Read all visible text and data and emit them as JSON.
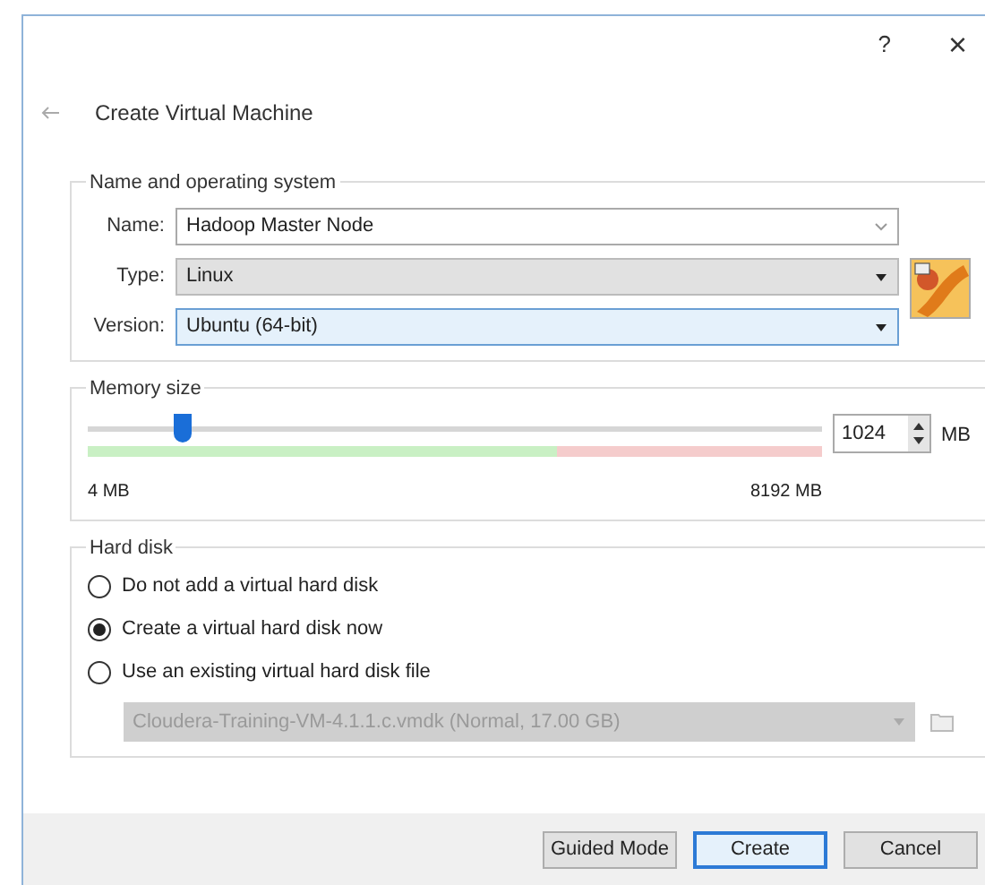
{
  "title_bar": {
    "help": "?",
    "close": "×"
  },
  "title": "Create Virtual Machine",
  "name_os": {
    "legend": "Name and operating system",
    "fields": [
      {
        "kind": "combo",
        "label": "Name:",
        "value": "Hadoop Master Node"
      },
      {
        "kind": "select",
        "label": "Type:",
        "value": "Linux",
        "focused": false
      },
      {
        "kind": "select",
        "label": "Version:",
        "value": "Ubuntu (64-bit)",
        "focused": true
      }
    ]
  },
  "memory": {
    "legend": "Memory size",
    "level": 0.13,
    "value": "1024",
    "unit": "MB",
    "min_label": "4 MB",
    "max_label": "8192 MB"
  },
  "hard_disk": {
    "legend": "Hard disk",
    "options": [
      {
        "label": "Do not add a virtual hard disk",
        "selected": false
      },
      {
        "label": "Create a virtual hard disk now",
        "selected": true
      },
      {
        "label": "Use an existing virtual hard disk file",
        "selected": false
      }
    ],
    "file": {
      "value": "Cloudera-Training-VM-4.1.1.c.vmdk (Normal, 17.00 GB)",
      "disabled": true
    }
  },
  "buttons": [
    {
      "label": "Guided Mode",
      "default": false
    },
    {
      "label": "Create",
      "default": true
    },
    {
      "label": "Cancel",
      "default": false
    }
  ]
}
